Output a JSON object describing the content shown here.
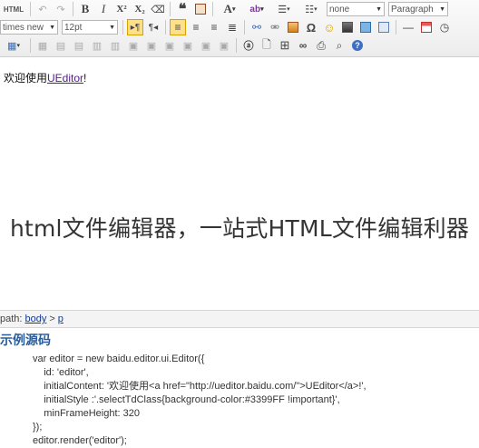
{
  "toolbar": {
    "html_label": "HTML",
    "font_family": "times new",
    "font_size": "12pt",
    "style_select": "none",
    "paragraph_select": "Paragraph"
  },
  "editor": {
    "content_prefix": "欢迎使用",
    "content_link": "UEditor",
    "content_suffix": "!"
  },
  "caption": "html文件编辑器，一站式HTML文件编辑利器",
  "pathbar": {
    "label": "path:",
    "items": [
      "body",
      "p"
    ],
    "separator": ">"
  },
  "example": {
    "title": "示例源码",
    "code_lines": [
      "var editor = new baidu.editor.ui.Editor({",
      "    id: 'editor',",
      "    initialContent: '欢迎使用<a href=\"http://ueditor.baidu.com/\">UEditor</a>!',",
      "    initialStyle :'.selectTdClass{background-color:#3399FF !important}',",
      "    minFrameHeight: 320",
      "});",
      "editor.render('editor');"
    ]
  }
}
